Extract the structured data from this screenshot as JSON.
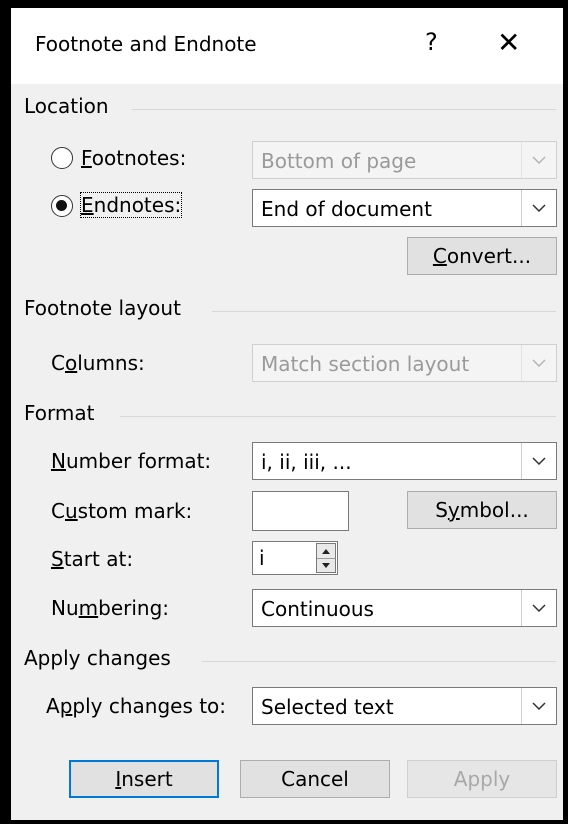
{
  "dialog": {
    "title": "Footnote and Endnote",
    "help_label": "?",
    "close_label": "✕"
  },
  "location": {
    "group_label": "Location",
    "footnotes": {
      "label_accel": "F",
      "label_rest": "ootnotes:",
      "selected": false,
      "value": "Bottom of page",
      "enabled": false
    },
    "endnotes": {
      "label_accel": "E",
      "label_rest": "ndnotes:",
      "selected": true,
      "value": "End of document",
      "enabled": true
    },
    "convert": {
      "accel": "C",
      "rest": "onvert..."
    }
  },
  "footnote_layout": {
    "group_label": "Footnote layout",
    "columns": {
      "pre": "C",
      "accel": "o",
      "post": "lumns:",
      "value": "Match section layout",
      "enabled": false
    }
  },
  "format": {
    "group_label": "Format",
    "number_format": {
      "accel": "N",
      "rest": "umber format:",
      "value": "i, ii, iii, ..."
    },
    "custom_mark": {
      "pre": "C",
      "accel": "u",
      "post": "stom mark:",
      "value": ""
    },
    "symbol": {
      "pre": "S",
      "accel": "y",
      "post": "mbol..."
    },
    "start_at": {
      "accel": "S",
      "rest": "tart at:",
      "value": "i"
    },
    "numbering": {
      "pre": "Nu",
      "accel": "m",
      "post": "bering:",
      "value": "Continuous"
    }
  },
  "apply_changes": {
    "group_label": "Apply changes",
    "apply_to": {
      "pre": "A",
      "accel": "p",
      "post": "ply changes to:",
      "value": "Selected text"
    }
  },
  "buttons": {
    "insert": {
      "accel": "I",
      "rest": "nsert"
    },
    "cancel": "Cancel",
    "apply": "Apply"
  }
}
